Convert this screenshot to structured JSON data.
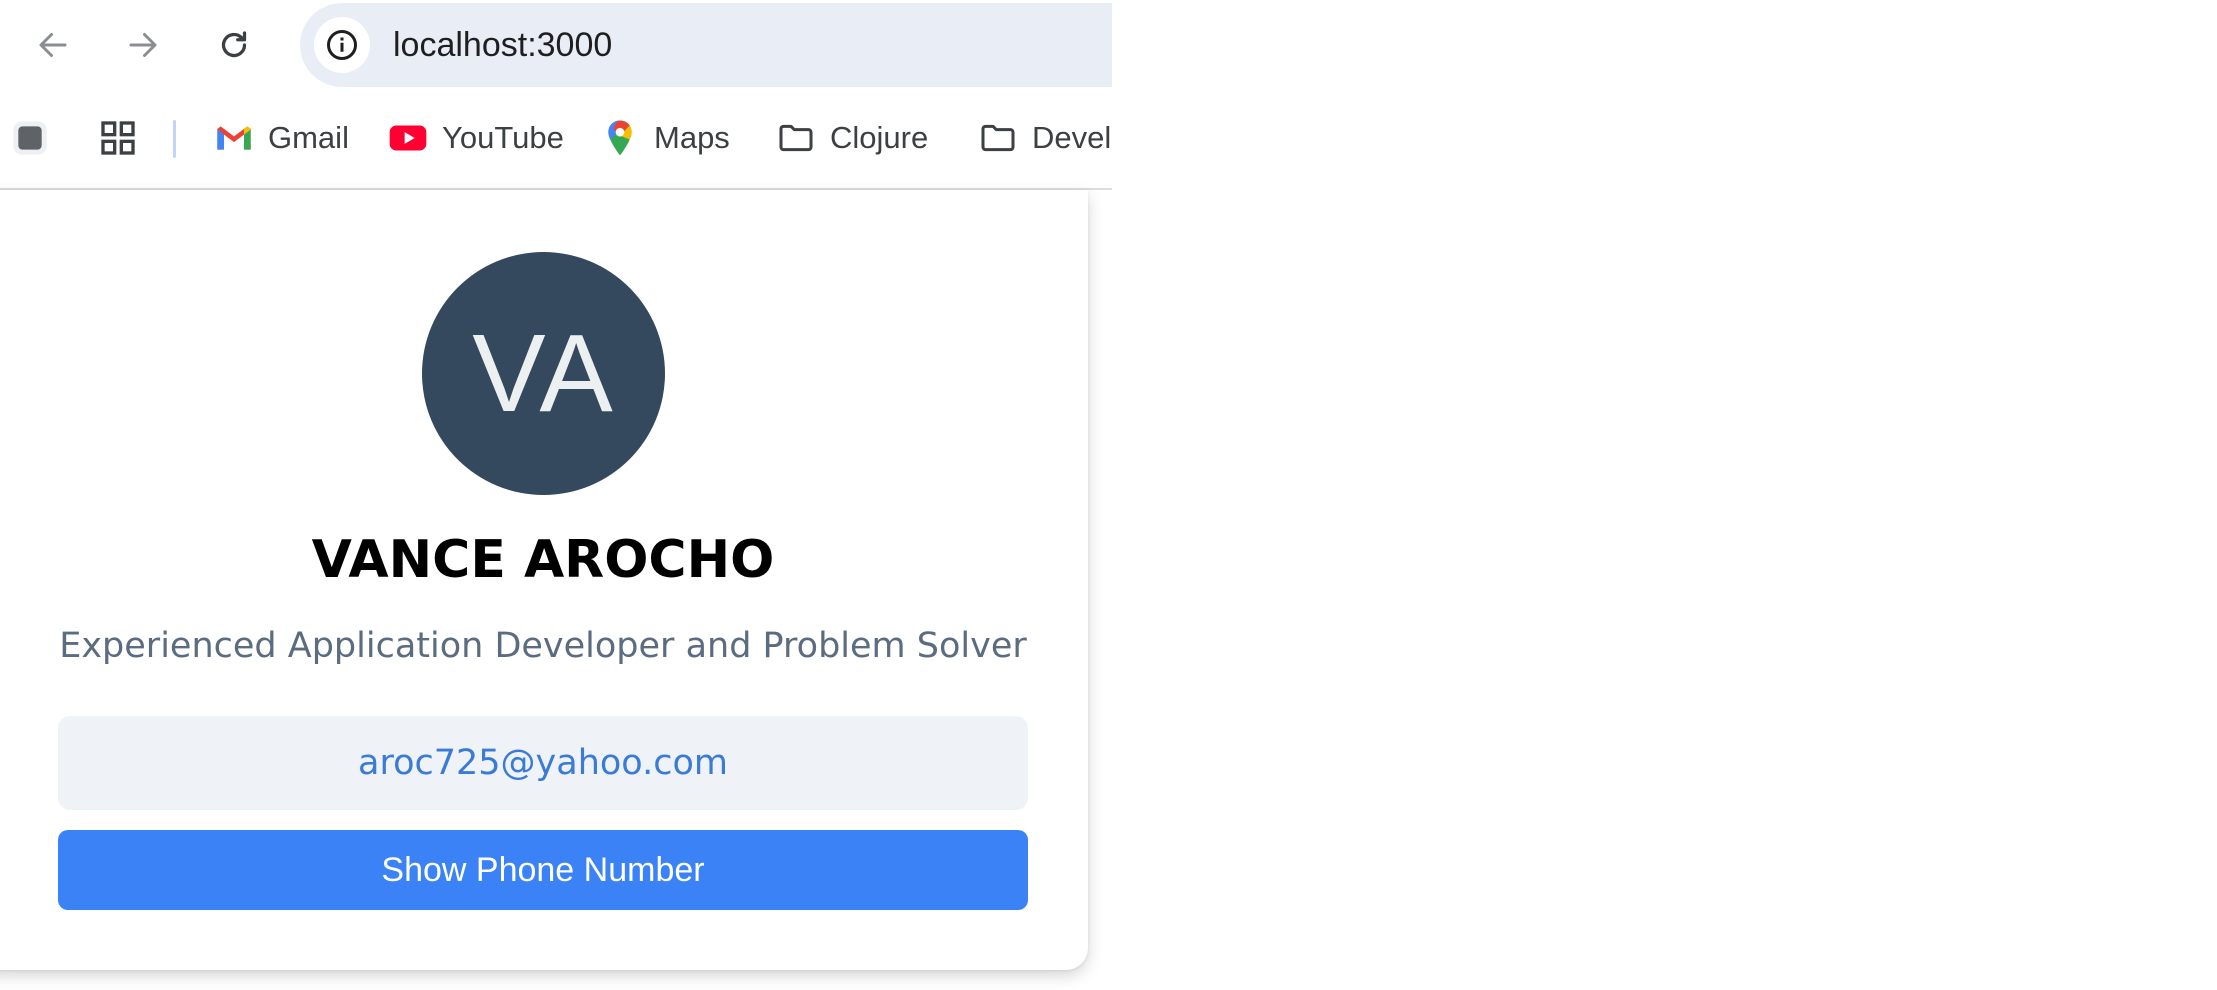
{
  "browser": {
    "url": "localhost:3000",
    "bookmarks": [
      {
        "label": "Gmail",
        "icon": "gmail-icon"
      },
      {
        "label": "YouTube",
        "icon": "youtube-icon"
      },
      {
        "label": "Maps",
        "icon": "maps-icon"
      },
      {
        "label": "Clojure",
        "icon": "folder-icon"
      },
      {
        "label": "Devel",
        "icon": "folder-icon"
      }
    ]
  },
  "profile": {
    "initials": "VA",
    "name": "VANCE AROCHO",
    "tagline": "Experienced Application Developer and Problem Solver",
    "email": "aroc725@yahoo.com",
    "phone_button": "Show Phone Number"
  },
  "colors": {
    "avatar_bg": "#34495e",
    "button_bg": "#3b82f6",
    "email_text": "#3a7bd5"
  }
}
